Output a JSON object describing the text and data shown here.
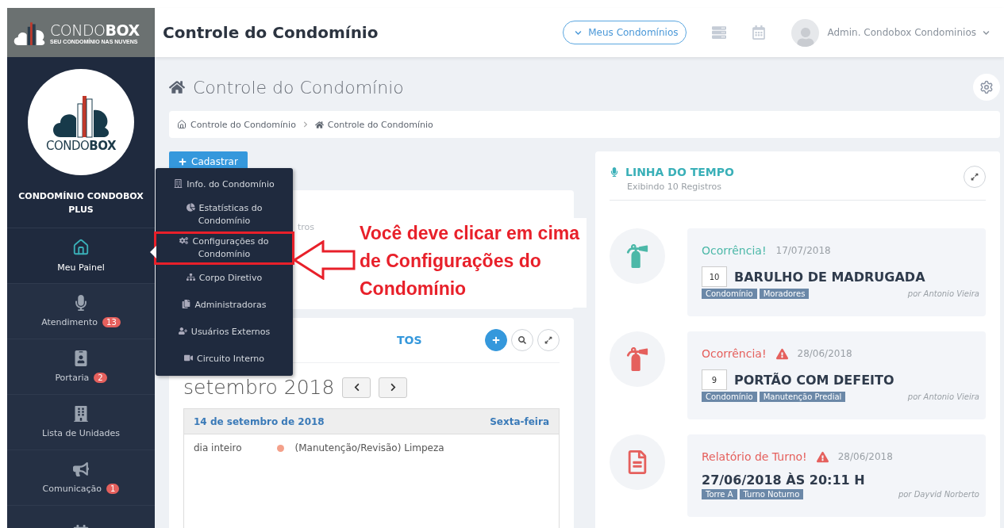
{
  "brand": {
    "logo_text": "CONDO**BOX**",
    "tagline": "SEU CONDOMÍNIO NAS NUVENS",
    "circle_logo_text": "CONDO**BOX**"
  },
  "topbar": {
    "title": "Controle do Condomínio",
    "condos_button": "Meus Condomínios",
    "user_name": "Admin. Condobox Condominios"
  },
  "sidebar": {
    "condo_name": "CONDOMÍNIO CONDOBOX PLUS",
    "items": [
      {
        "kind": "home",
        "label": "Meu Painel",
        "selected": true
      },
      {
        "kind": "mic",
        "label": "Atendimento",
        "badge": "13",
        "selected": false
      },
      {
        "kind": "badge",
        "label": "Portaria",
        "badge": "2",
        "selected": false
      },
      {
        "kind": "building",
        "label": "Lista de Unidades",
        "selected": false
      },
      {
        "kind": "megaphone",
        "label": "Comunicação",
        "badge": "1",
        "selected": false
      },
      {
        "kind": "calendar",
        "selected": false
      }
    ]
  },
  "page": {
    "title": "Controle do Condomínio",
    "breadcrumb": [
      "Controle do Condomínio",
      "Controle do Condomínio"
    ],
    "add_button": "Cadastrar"
  },
  "popup_menu": {
    "items": [
      {
        "kind": "building",
        "label": "Info. do Condomínio",
        "highlighted": false
      },
      {
        "kind": "chart",
        "label": "Estatísticas do Condomínio",
        "highlighted": false
      },
      {
        "kind": "gears",
        "label": "Configurações do Condomínio",
        "highlighted": true
      },
      {
        "kind": "sitemap",
        "label": "Corpo Diretivo",
        "highlighted": false
      },
      {
        "kind": "copy",
        "label": "Administradoras",
        "highlighted": false
      },
      {
        "kind": "user",
        "label": "Usuários Externos",
        "highlighted": false
      },
      {
        "kind": "video",
        "label": "Circuito Interno",
        "highlighted": false
      }
    ]
  },
  "annotation": {
    "text": "Você deve clicar em cima de Configurações do Condomínio"
  },
  "hidden_card": {
    "visible_text": "tros"
  },
  "calendar": {
    "title_visible": "TOS",
    "month": "setembro 2018",
    "day_header": "14 de setembro de 2018",
    "weekday": "Sexta-feira",
    "events": [
      {
        "time": "dia inteiro",
        "title": "(Manutenção/Revisão) Limpeza",
        "color": "#f4a08a"
      }
    ]
  },
  "timeline": {
    "title": "LINHA DO TEMPO",
    "subtitle": "Exibindo 10 Registros",
    "items": [
      {
        "kind": "extinguisher",
        "color": "#4cb8a8",
        "type": "Ocorrência!",
        "warning": false,
        "date": "17/07/2018",
        "number": "10",
        "heading": "BARULHO DE MADRUGADA",
        "tags": [
          "Condomínio",
          "Moradores"
        ],
        "author": "por Antonio Vieira"
      },
      {
        "kind": "extinguisher",
        "color": "#e5605d",
        "type": "Ocorrência!",
        "warning": true,
        "date": "28/06/2018",
        "number": "9",
        "heading": "PORTÃO COM DEFEITO",
        "tags": [
          "Condomínio",
          "Manutenção Predial"
        ],
        "author": "por Antonio Vieira"
      },
      {
        "kind": "document",
        "color": "#e5605d",
        "type": "Relatório de Turno!",
        "warning": true,
        "date": "28/06/2018",
        "heading": "27/06/2018 ÀS 20:11 H",
        "tags": [
          "Torre A",
          "Turno Noturno"
        ],
        "author": "por Dayvid Norberto"
      }
    ]
  }
}
